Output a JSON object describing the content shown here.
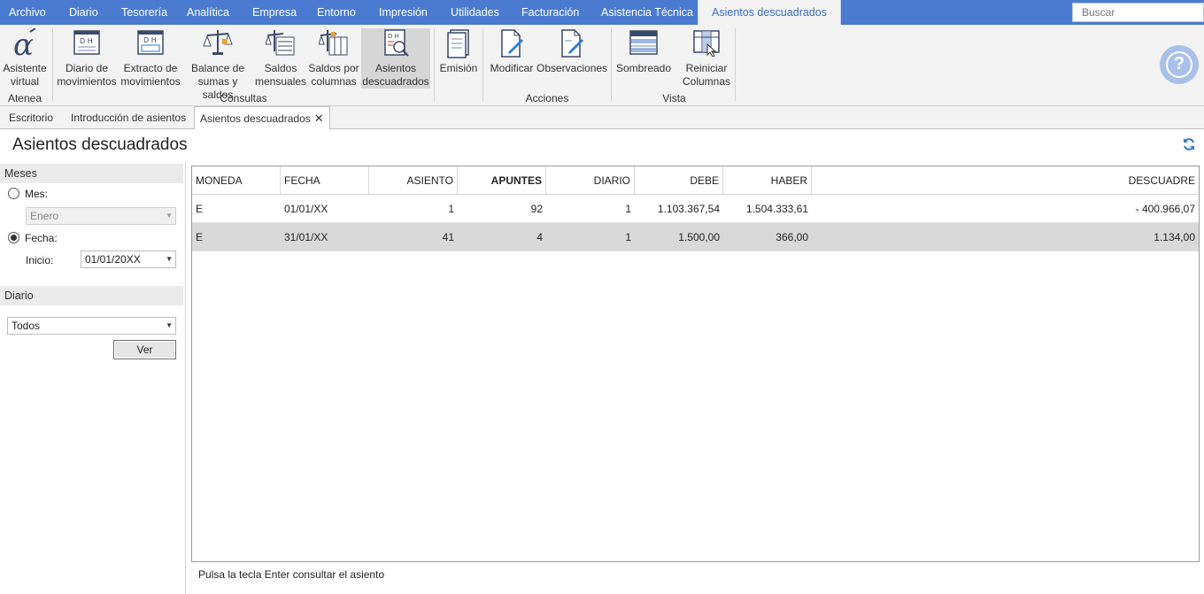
{
  "menu": {
    "items": [
      "Archivo",
      "Diario",
      "Tesorería",
      "Analítica",
      "Empresa",
      "Entorno",
      "Impresión",
      "Utilidades",
      "Facturación",
      "Asistencia Técnica",
      "Asientos descuadrados"
    ],
    "search_placeholder": "Buscar"
  },
  "ribbon": {
    "buttons": [
      {
        "label": "Asistente\nvirtual",
        "icon": "alpha-icon"
      },
      {
        "label": "Diario de\nmovimientos",
        "icon": "journal-dh-icon"
      },
      {
        "label": "Extracto de\nmovimientos",
        "icon": "extract-dh-icon"
      },
      {
        "label": "Balance de\nsumas y saldos",
        "icon": "balance-scale-icon"
      },
      {
        "label": "Saldos\nmensuales",
        "icon": "monthly-balance-icon"
      },
      {
        "label": "Saldos por\ncolumnas",
        "icon": "column-balance-icon"
      },
      {
        "label": "Asientos\ndescuadrados",
        "icon": "unbalanced-search-icon"
      },
      {
        "label": "Emisión",
        "icon": "print-document-icon"
      },
      {
        "label": "Modificar",
        "icon": "edit-document-icon"
      },
      {
        "label": "Observaciones",
        "icon": "notes-document-icon"
      },
      {
        "label": "Sombreado",
        "icon": "shading-icon"
      },
      {
        "label": "Reiniciar\nColumnas",
        "icon": "reset-columns-icon"
      }
    ],
    "groups": [
      "Atenea",
      "Consultas",
      "Acciones",
      "Vista"
    ]
  },
  "tabs": [
    "Escritorio",
    "Introducción de asientos",
    "Asientos descuadrados"
  ],
  "page": {
    "title": "Asientos descuadrados",
    "status_text": "Pulsa la tecla Enter consultar el asiento"
  },
  "filters": {
    "meses_header": "Meses",
    "mes_label": "Mes:",
    "mes_value": "Enero",
    "fecha_label": "Fecha:",
    "inicio_label": "Inicio:",
    "inicio_value": "01/01/20XX",
    "diario_header": "Diario",
    "diario_value": "Todos",
    "ver_label": "Ver"
  },
  "grid": {
    "columns": [
      "MONEDA",
      "FECHA",
      "ASIENTO",
      "APUNTES",
      "DIARIO",
      "DEBE",
      "HABER",
      "DESCUADRE"
    ],
    "rows": [
      [
        "E",
        "01/01/XX",
        "1",
        "92",
        "1",
        "1.103.367,54",
        "1.504.333,61",
        "- 400.966,07"
      ],
      [
        "E",
        "31/01/XX",
        "41",
        "4",
        "1",
        "1.500,00",
        "366,00",
        "1.134,00"
      ]
    ]
  },
  "colors": {
    "menubar": "#4a7bd0",
    "accent": "#2f7ad8",
    "selected_row": "#d9d9d9"
  }
}
